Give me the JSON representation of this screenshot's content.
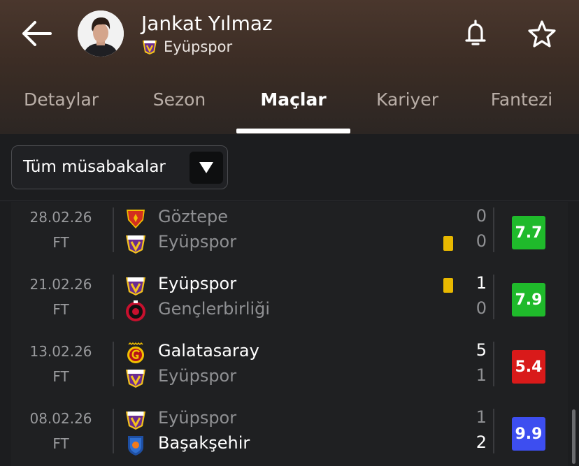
{
  "header": {
    "player_name": "Jankat Yılmaz",
    "team_name": "Eyüpspor"
  },
  "tabs": [
    {
      "label": "Detaylar",
      "active": false
    },
    {
      "label": "Sezon",
      "active": false
    },
    {
      "label": "Maçlar",
      "active": true
    },
    {
      "label": "Kariyer",
      "active": false
    },
    {
      "label": "Fantezi",
      "active": false
    }
  ],
  "filter": {
    "selected": "Tüm müsabakalar"
  },
  "matches": [
    {
      "date": "28.02.26",
      "status": "FT",
      "home": {
        "name": "Göztepe",
        "logo": "goztepe-logo",
        "score": "0",
        "winner": false,
        "yellow_card": false
      },
      "away": {
        "name": "Eyüpspor",
        "logo": "eyupspor-logo",
        "score": "0",
        "winner": false,
        "yellow_card": true
      },
      "rating": "7.7",
      "rating_color": "#1fba2b"
    },
    {
      "date": "21.02.26",
      "status": "FT",
      "home": {
        "name": "Eyüpspor",
        "logo": "eyupspor-logo",
        "score": "1",
        "winner": true,
        "yellow_card": true
      },
      "away": {
        "name": "Gençlerbirliği",
        "logo": "genclerbirligi-logo",
        "score": "0",
        "winner": false,
        "yellow_card": false
      },
      "rating": "7.9",
      "rating_color": "#1fba2b"
    },
    {
      "date": "13.02.26",
      "status": "FT",
      "home": {
        "name": "Galatasaray",
        "logo": "galatasaray-logo",
        "score": "5",
        "winner": true,
        "yellow_card": false
      },
      "away": {
        "name": "Eyüpspor",
        "logo": "eyupspor-logo",
        "score": "1",
        "winner": false,
        "yellow_card": false
      },
      "rating": "5.4",
      "rating_color": "#d91a1a"
    },
    {
      "date": "08.02.26",
      "status": "FT",
      "home": {
        "name": "Eyüpspor",
        "logo": "eyupspor-logo",
        "score": "1",
        "winner": false,
        "yellow_card": false
      },
      "away": {
        "name": "Başakşehir",
        "logo": "basaksehir-logo",
        "score": "2",
        "winner": true,
        "yellow_card": false
      },
      "rating": "9.9",
      "rating_color": "#3d4ef0"
    }
  ],
  "icons": {
    "back": "arrow-left-icon",
    "bell": "bell-icon",
    "star": "star-icon",
    "dropdown": "triangle-down-icon"
  }
}
